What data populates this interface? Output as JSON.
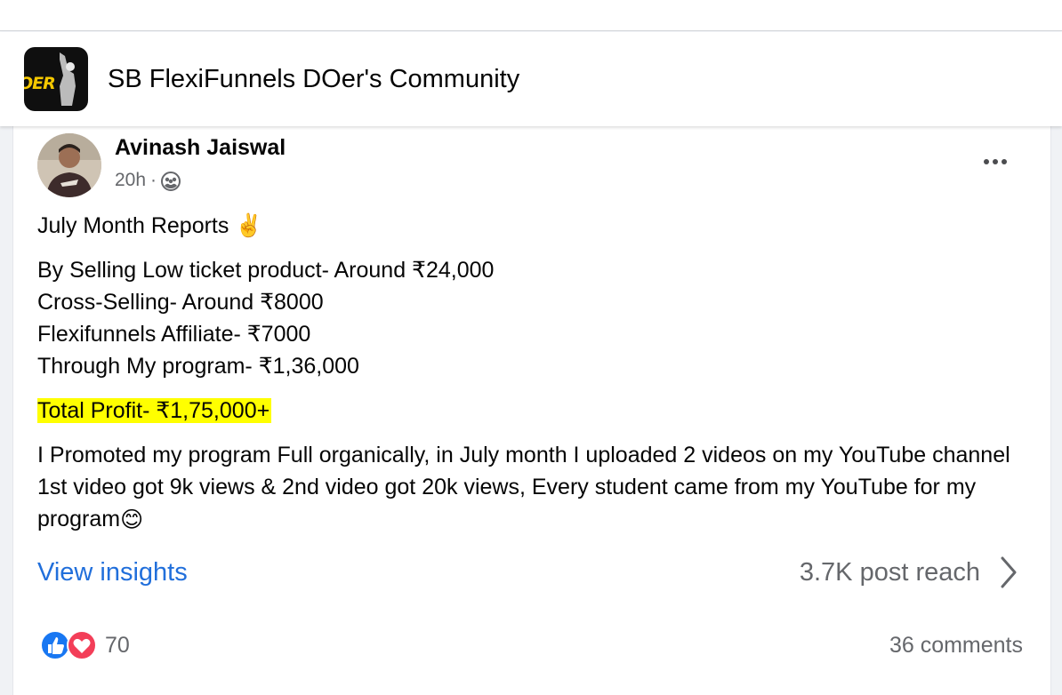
{
  "group": {
    "name": "SB FlexiFunnels DOer's Community",
    "logo_text": "OER"
  },
  "post": {
    "author": "Avinash Jaiswal",
    "time": "20h",
    "separator": "·",
    "privacy_icon": "group-privacy-icon",
    "more_icon": "more-options-icon",
    "title": "July Month Reports ✌️",
    "lines": [
      "By Selling Low ticket product- Around ₹24,000",
      "Cross-Selling- Around ₹8000",
      "Flexifunnels Affiliate- ₹7000",
      "Through My program- ₹1,36,000"
    ],
    "total": "Total Profit- ₹1,75,000+",
    "description": "I Promoted my program Full organically, in July month I uploaded 2 videos on my YouTube channel 1st video got 9k views & 2nd video got 20k views, Every student came from my YouTube for my program",
    "description_emoji": "😊",
    "highlight_color": "#ffff00"
  },
  "insights": {
    "link_label": "View insights",
    "reach": "3.7K post reach"
  },
  "reactions": {
    "count": "70",
    "types": [
      "like",
      "love"
    ],
    "comments": "36 comments"
  },
  "colors": {
    "link_blue": "#216fdb",
    "secondary_text": "#65676b",
    "like_blue": "#1877f2",
    "love_red": "#f33e58"
  }
}
